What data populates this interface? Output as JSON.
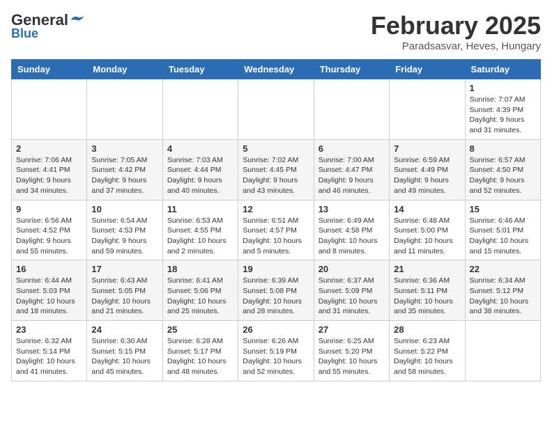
{
  "header": {
    "logo_general": "General",
    "logo_blue": "Blue",
    "month_title": "February 2025",
    "location": "Paradsasvar, Heves, Hungary"
  },
  "weekdays": [
    "Sunday",
    "Monday",
    "Tuesday",
    "Wednesday",
    "Thursday",
    "Friday",
    "Saturday"
  ],
  "weeks": [
    [
      {
        "day": "",
        "info": ""
      },
      {
        "day": "",
        "info": ""
      },
      {
        "day": "",
        "info": ""
      },
      {
        "day": "",
        "info": ""
      },
      {
        "day": "",
        "info": ""
      },
      {
        "day": "",
        "info": ""
      },
      {
        "day": "1",
        "info": "Sunrise: 7:07 AM\nSunset: 4:39 PM\nDaylight: 9 hours and 31 minutes."
      }
    ],
    [
      {
        "day": "2",
        "info": "Sunrise: 7:06 AM\nSunset: 4:41 PM\nDaylight: 9 hours and 34 minutes."
      },
      {
        "day": "3",
        "info": "Sunrise: 7:05 AM\nSunset: 4:42 PM\nDaylight: 9 hours and 37 minutes."
      },
      {
        "day": "4",
        "info": "Sunrise: 7:03 AM\nSunset: 4:44 PM\nDaylight: 9 hours and 40 minutes."
      },
      {
        "day": "5",
        "info": "Sunrise: 7:02 AM\nSunset: 4:45 PM\nDaylight: 9 hours and 43 minutes."
      },
      {
        "day": "6",
        "info": "Sunrise: 7:00 AM\nSunset: 4:47 PM\nDaylight: 9 hours and 46 minutes."
      },
      {
        "day": "7",
        "info": "Sunrise: 6:59 AM\nSunset: 4:49 PM\nDaylight: 9 hours and 49 minutes."
      },
      {
        "day": "8",
        "info": "Sunrise: 6:57 AM\nSunset: 4:50 PM\nDaylight: 9 hours and 52 minutes."
      }
    ],
    [
      {
        "day": "9",
        "info": "Sunrise: 6:56 AM\nSunset: 4:52 PM\nDaylight: 9 hours and 55 minutes."
      },
      {
        "day": "10",
        "info": "Sunrise: 6:54 AM\nSunset: 4:53 PM\nDaylight: 9 hours and 59 minutes."
      },
      {
        "day": "11",
        "info": "Sunrise: 6:53 AM\nSunset: 4:55 PM\nDaylight: 10 hours and 2 minutes."
      },
      {
        "day": "12",
        "info": "Sunrise: 6:51 AM\nSunset: 4:57 PM\nDaylight: 10 hours and 5 minutes."
      },
      {
        "day": "13",
        "info": "Sunrise: 6:49 AM\nSunset: 4:58 PM\nDaylight: 10 hours and 8 minutes."
      },
      {
        "day": "14",
        "info": "Sunrise: 6:48 AM\nSunset: 5:00 PM\nDaylight: 10 hours and 11 minutes."
      },
      {
        "day": "15",
        "info": "Sunrise: 6:46 AM\nSunset: 5:01 PM\nDaylight: 10 hours and 15 minutes."
      }
    ],
    [
      {
        "day": "16",
        "info": "Sunrise: 6:44 AM\nSunset: 5:03 PM\nDaylight: 10 hours and 18 minutes."
      },
      {
        "day": "17",
        "info": "Sunrise: 6:43 AM\nSunset: 5:05 PM\nDaylight: 10 hours and 21 minutes."
      },
      {
        "day": "18",
        "info": "Sunrise: 6:41 AM\nSunset: 5:06 PM\nDaylight: 10 hours and 25 minutes."
      },
      {
        "day": "19",
        "info": "Sunrise: 6:39 AM\nSunset: 5:08 PM\nDaylight: 10 hours and 28 minutes."
      },
      {
        "day": "20",
        "info": "Sunrise: 6:37 AM\nSunset: 5:09 PM\nDaylight: 10 hours and 31 minutes."
      },
      {
        "day": "21",
        "info": "Sunrise: 6:36 AM\nSunset: 5:11 PM\nDaylight: 10 hours and 35 minutes."
      },
      {
        "day": "22",
        "info": "Sunrise: 6:34 AM\nSunset: 5:12 PM\nDaylight: 10 hours and 38 minutes."
      }
    ],
    [
      {
        "day": "23",
        "info": "Sunrise: 6:32 AM\nSunset: 5:14 PM\nDaylight: 10 hours and 41 minutes."
      },
      {
        "day": "24",
        "info": "Sunrise: 6:30 AM\nSunset: 5:15 PM\nDaylight: 10 hours and 45 minutes."
      },
      {
        "day": "25",
        "info": "Sunrise: 6:28 AM\nSunset: 5:17 PM\nDaylight: 10 hours and 48 minutes."
      },
      {
        "day": "26",
        "info": "Sunrise: 6:26 AM\nSunset: 5:19 PM\nDaylight: 10 hours and 52 minutes."
      },
      {
        "day": "27",
        "info": "Sunrise: 6:25 AM\nSunset: 5:20 PM\nDaylight: 10 hours and 55 minutes."
      },
      {
        "day": "28",
        "info": "Sunrise: 6:23 AM\nSunset: 5:22 PM\nDaylight: 10 hours and 58 minutes."
      },
      {
        "day": "",
        "info": ""
      }
    ]
  ]
}
